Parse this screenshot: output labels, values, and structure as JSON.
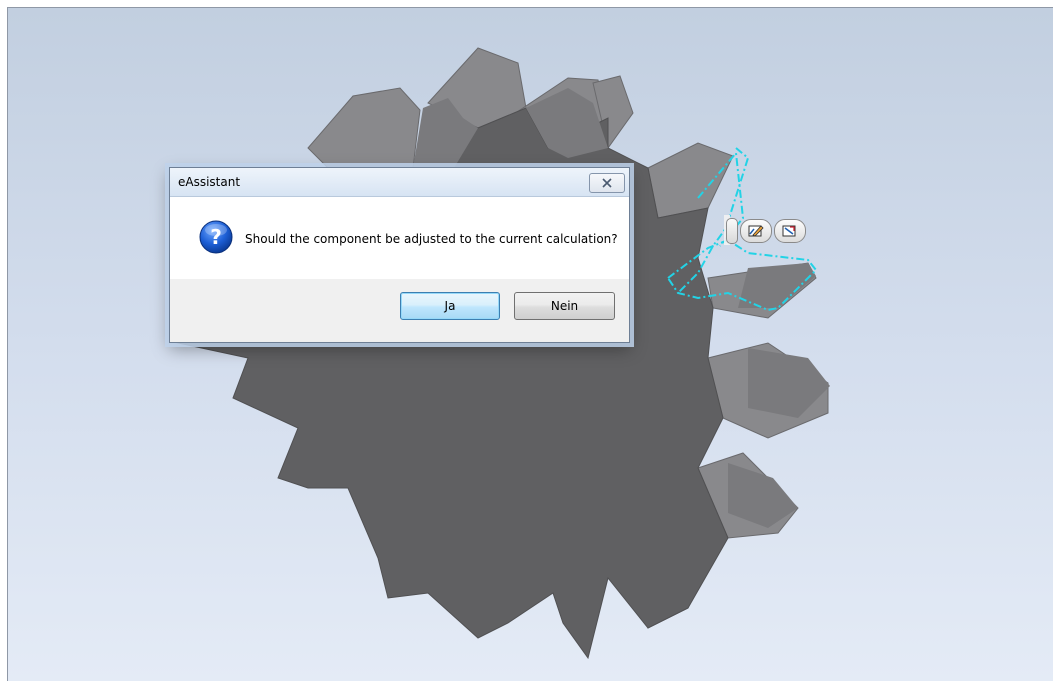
{
  "dialog": {
    "title": "eAssistant",
    "message": "Should the component be adjusted to the current calculation?",
    "yes_label": "Ja",
    "no_label": "Nein",
    "icon": "question-icon"
  },
  "mini_toolbar": {
    "items": [
      "edit-sketch-icon",
      "edit-feature-icon"
    ]
  },
  "colors": {
    "viewport_top": "#c2cfe0",
    "viewport_bottom": "#e4ebf6",
    "gear_face": "#5e5e60",
    "gear_side": "#868689",
    "selection_highlight": "#22d3e6"
  }
}
